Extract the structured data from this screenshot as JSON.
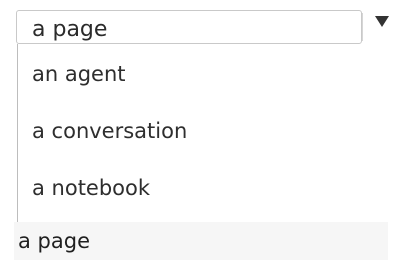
{
  "combobox": {
    "selected_value": "a page",
    "arrow_icon": "chevron-down-icon"
  },
  "dropdown": {
    "options": [
      {
        "label": "an agent"
      },
      {
        "label": "a conversation"
      },
      {
        "label": "a notebook"
      },
      {
        "label": "a page"
      }
    ]
  }
}
